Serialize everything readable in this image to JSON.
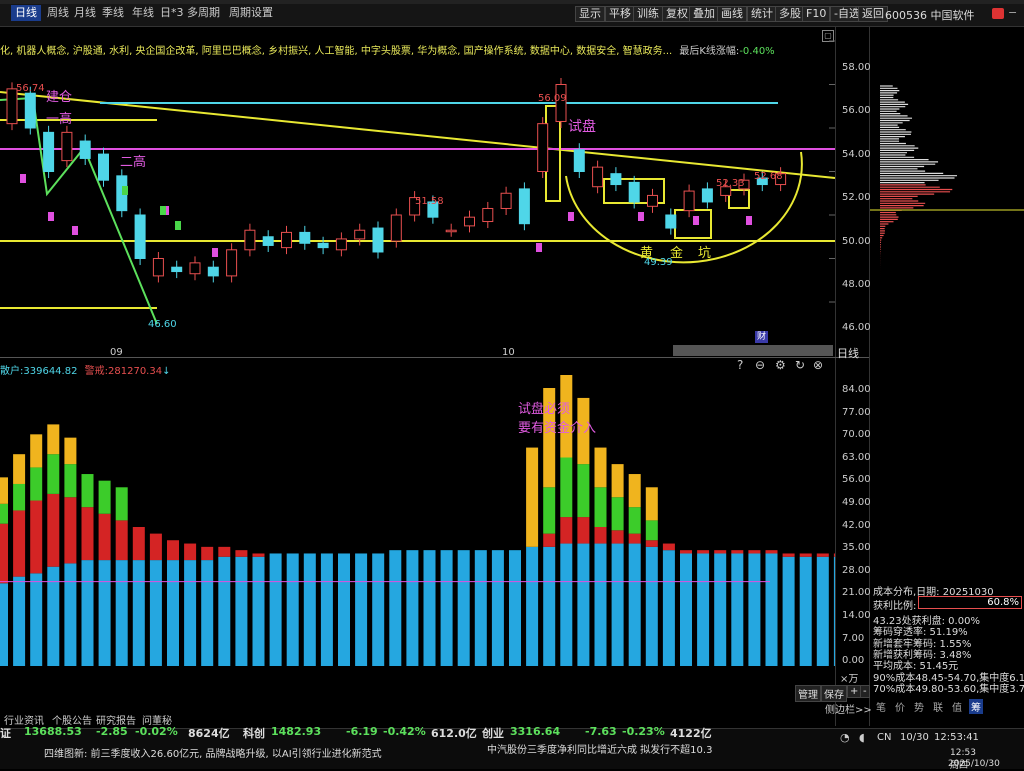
{
  "toolbar": {
    "tabs": [
      "日线",
      "周线",
      "月线",
      "季线",
      "年线",
      "日*3",
      "多周期",
      "周期设置"
    ],
    "right_buttons": [
      "显示",
      "平移",
      "训练",
      "复权",
      "叠加",
      "画线",
      "统计",
      "多股",
      "F10",
      "-自选",
      "返回"
    ],
    "stock_title": "600536 中国软件"
  },
  "concepts_line": "化, 机器人概念, 沪股通, 水利, 央企国企改革, 阿里巴巴概念, 乡村振兴, 人工智能, 中字头股票, 华为概念, 国产操作系统, 数据中心, 数据安全, 智慧政务...",
  "kline_rise_label": "最后K线涨幅:",
  "kline_rise_value": "-0.40%",
  "price_axis": [
    "58.00",
    "56.00",
    "54.00",
    "52.00",
    "50.00",
    "48.00",
    "46.00"
  ],
  "price_labels": [
    "56.74",
    "56.09",
    "51.58",
    "52.33",
    "52.68",
    "49.39",
    "46.60"
  ],
  "annotations": {
    "jianzhong": "建仓",
    "yigao": "一高",
    "ergao": "二高",
    "shipan": "试盘",
    "huang": "黄",
    "jin": "金",
    "keng": "坑"
  },
  "date_labels": [
    "09",
    "10"
  ],
  "cai_badge": "财",
  "period_label": "日线",
  "volume_header": {
    "left": "散户:339644.82",
    "right": "警戒:281270.34"
  },
  "volume_annotation": [
    "试盘必须",
    "要有资金介入"
  ],
  "volume_axis": [
    "84.00",
    "77.00",
    "70.00",
    "63.00",
    "56.00",
    "49.00",
    "42.00",
    "35.00",
    "28.00",
    "21.00",
    "14.00",
    "7.00",
    "0.00"
  ],
  "volume_unit": "×万",
  "chart_controls": {
    "manage": "管理",
    "save": "保存",
    "plus": "+",
    "minus": "-",
    "sidebar_toggle": "侧边栏>>"
  },
  "right_panel": {
    "title": "成本分布,日期: 20251030",
    "profit_label": "获利比例:",
    "profit_value": "60.8%",
    "lines": [
      "43.23处获利盘: 0.00%",
      "筹码穿透率: 51.19%",
      "新增套牢筹码: 1.55%",
      "新增获利筹码: 3.48%",
      "平均成本: 51.45元",
      "90%成本48.45-54.70,集中度6.1%",
      "70%成本49.80-53.60,集中度3.7%"
    ],
    "bottom_tabs": [
      "笔",
      "价",
      "势",
      "联",
      "值",
      "筹"
    ]
  },
  "bottom_tabs": [
    "行业资讯",
    "个股公告",
    "研究报告",
    "问董秘"
  ],
  "indices": [
    {
      "name": "证",
      "value": "13688.53",
      "change": "-2.85",
      "pct": "-0.02%",
      "amount": "8624亿"
    },
    {
      "name": "科创",
      "value": "1482.93",
      "change": "-6.19",
      "pct": "-0.42%",
      "amount": "612.0亿"
    },
    {
      "name": "创业",
      "value": "3316.64",
      "change": "-7.63",
      "pct": "-0.23%",
      "amount": "4122亿"
    }
  ],
  "news_left": "四维图新: 前三季度收入26.60亿元, 品牌战略升级, 以AI引领行业进化新范式",
  "news_right": "中汽股份三季度净利同比增近六成 拟发行不超10.3",
  "clock": {
    "tray": "CN",
    "date": "10/30",
    "time": "12:53:41",
    "os_time": "12:53 周四",
    "os_date": "2025/10/30"
  },
  "chart_data": {
    "type": "bar",
    "title": "",
    "xlabel": "",
    "ylabel": "",
    "candles_approx": [
      {
        "o": 54.2,
        "c": 55.8
      },
      {
        "o": 55.6,
        "c": 54.0
      },
      {
        "o": 53.8,
        "c": 52.0
      },
      {
        "o": 52.5,
        "c": 53.8
      },
      {
        "o": 53.4,
        "c": 52.6
      },
      {
        "o": 52.8,
        "c": 51.6
      },
      {
        "o": 51.8,
        "c": 50.2
      },
      {
        "o": 50.0,
        "c": 48.0
      },
      {
        "o": 47.2,
        "c": 48.0
      },
      {
        "o": 47.6,
        "c": 47.4
      },
      {
        "o": 47.3,
        "c": 47.8
      },
      {
        "o": 47.6,
        "c": 47.2
      },
      {
        "o": 47.2,
        "c": 48.4
      },
      {
        "o": 48.4,
        "c": 49.3
      },
      {
        "o": 49.0,
        "c": 48.6
      },
      {
        "o": 48.5,
        "c": 49.2
      },
      {
        "o": 49.2,
        "c": 48.7
      },
      {
        "o": 48.7,
        "c": 48.5
      },
      {
        "o": 48.4,
        "c": 48.9
      },
      {
        "o": 48.9,
        "c": 49.3
      },
      {
        "o": 49.4,
        "c": 48.3
      },
      {
        "o": 48.8,
        "c": 50.0
      },
      {
        "o": 50.0,
        "c": 50.8
      },
      {
        "o": 50.6,
        "c": 49.9
      },
      {
        "o": 49.3,
        "c": 49.3
      },
      {
        "o": 49.5,
        "c": 49.9
      },
      {
        "o": 49.7,
        "c": 50.3
      },
      {
        "o": 50.3,
        "c": 51.0
      },
      {
        "o": 51.2,
        "c": 49.6
      },
      {
        "o": 52.0,
        "c": 54.2
      },
      {
        "o": 54.3,
        "c": 56.0
      },
      {
        "o": 53.0,
        "c": 52.0
      },
      {
        "o": 51.3,
        "c": 52.2
      },
      {
        "o": 51.9,
        "c": 51.4
      },
      {
        "o": 51.5,
        "c": 50.6
      },
      {
        "o": 50.4,
        "c": 50.9
      },
      {
        "o": 50.0,
        "c": 49.4
      },
      {
        "o": 50.2,
        "c": 51.1
      },
      {
        "o": 51.2,
        "c": 50.6
      },
      {
        "o": 50.9,
        "c": 51.3
      },
      {
        "o": 51.2,
        "c": 51.6
      },
      {
        "o": 51.7,
        "c": 51.4
      },
      {
        "o": 51.4,
        "c": 51.9
      }
    ],
    "volume_series": [
      {
        "name": "散户",
        "values": [
          25,
          27,
          28,
          30,
          31,
          32,
          32,
          32,
          32,
          32,
          32,
          32,
          32,
          33,
          33,
          33,
          34,
          34,
          34,
          34,
          34,
          34,
          34,
          35,
          35,
          35,
          35,
          35,
          35,
          35,
          35,
          36,
          36,
          37,
          37,
          37,
          37,
          37,
          36,
          35,
          34,
          34,
          34,
          34,
          34,
          34,
          33,
          33,
          33,
          33,
          33,
          33,
          33,
          34
        ]
      }
    ],
    "ylim": [
      0,
      84
    ]
  }
}
